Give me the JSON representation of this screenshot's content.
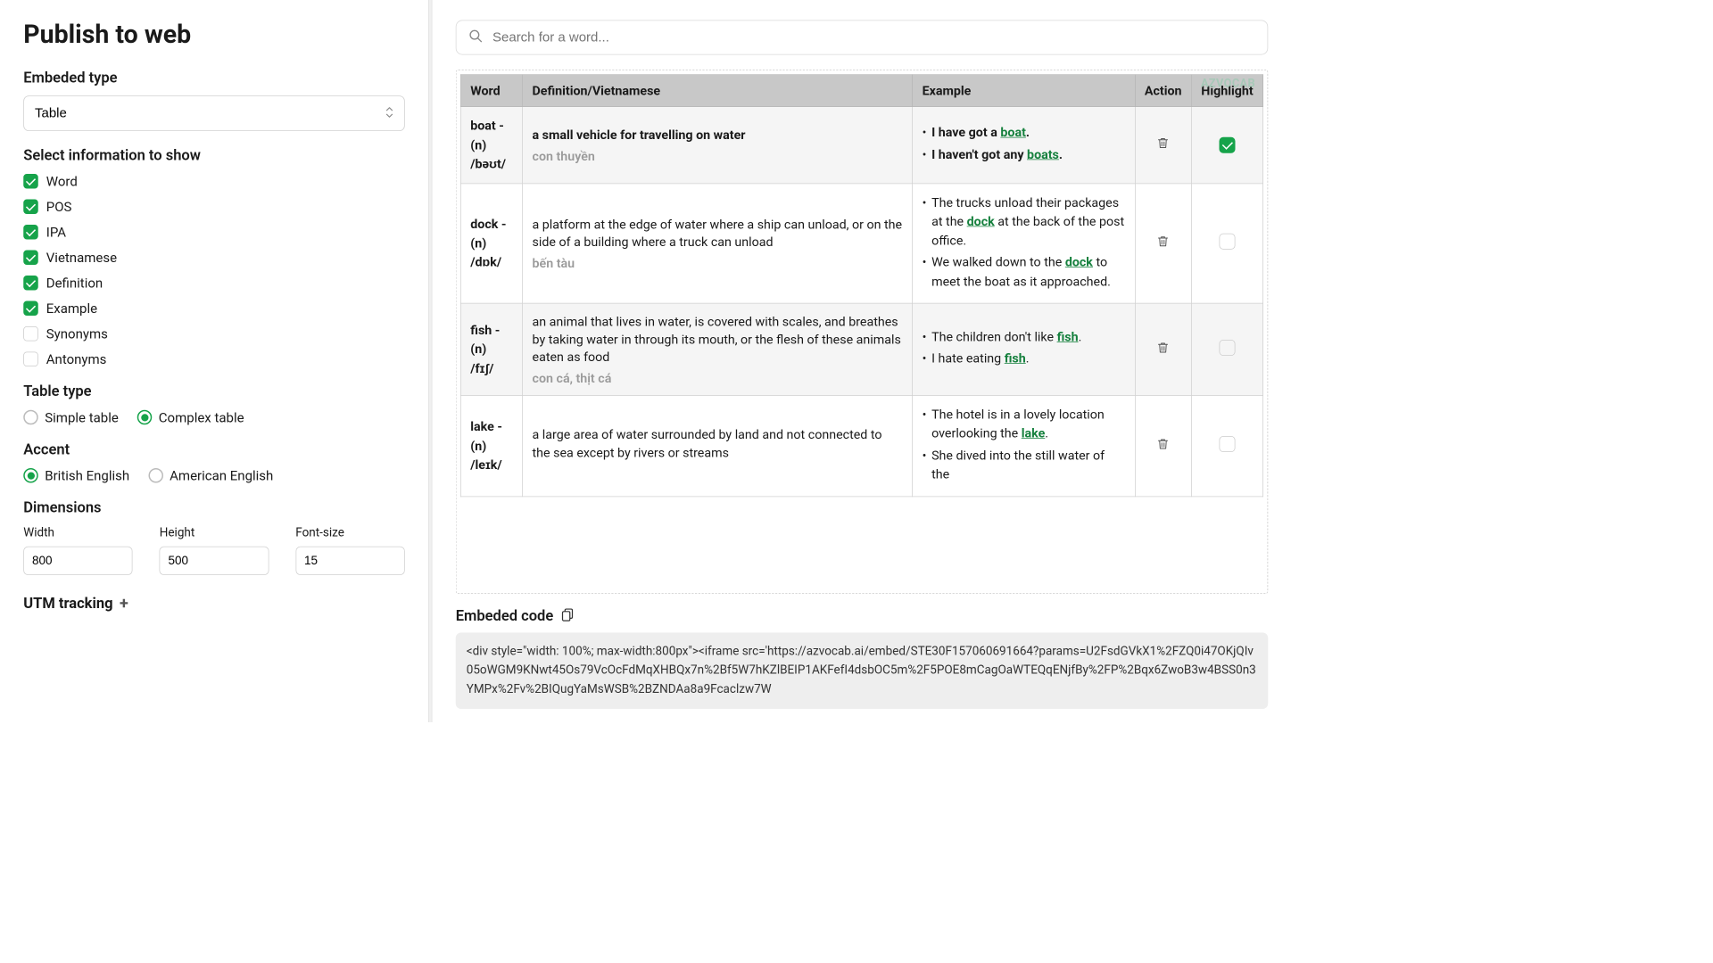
{
  "title": "Publish to web",
  "embed_type": {
    "label": "Embeded type",
    "value": "Table"
  },
  "info": {
    "label": "Select information to show",
    "items": [
      {
        "label": "Word",
        "on": true
      },
      {
        "label": "POS",
        "on": true
      },
      {
        "label": "IPA",
        "on": true
      },
      {
        "label": "Vietnamese",
        "on": true
      },
      {
        "label": "Definition",
        "on": true
      },
      {
        "label": "Example",
        "on": true
      },
      {
        "label": "Synonyms",
        "on": false
      },
      {
        "label": "Antonyms",
        "on": false
      }
    ]
  },
  "table_type": {
    "label": "Table type",
    "options": [
      "Simple table",
      "Complex table"
    ],
    "selected": "Complex table"
  },
  "accent": {
    "label": "Accent",
    "options": [
      "British English",
      "American English"
    ],
    "selected": "British English"
  },
  "dimensions": {
    "label": "Dimensions",
    "width": {
      "label": "Width",
      "value": "800"
    },
    "height": {
      "label": "Height",
      "value": "500"
    },
    "fontsize": {
      "label": "Font-size",
      "value": "15"
    }
  },
  "utm_label": "UTM tracking",
  "search": {
    "placeholder": "Search for a word..."
  },
  "watermark": "AZVOCAB",
  "columns": {
    "word": "Word",
    "def": "Definition/Vietnamese",
    "ex": "Example",
    "act": "Action",
    "hl": "Highlight"
  },
  "rows": [
    {
      "word": "boat - (n)",
      "ipa": "/bəʊt/",
      "def": "a small vehicle for travelling on water",
      "def_bold": true,
      "vn": "con thuyền",
      "ex": [
        {
          "pre": "I have got a ",
          "w": "boat",
          "post": ".",
          "bold": true
        },
        {
          "pre": "I haven't got any ",
          "w": "boats",
          "post": ".",
          "bold": true
        }
      ],
      "hl": true,
      "row_hl": true
    },
    {
      "word": "dock - (n)",
      "ipa": "/dɒk/",
      "def": "a platform at the edge of water where a ship can unload, or on the side of a building where a truck can unload",
      "def_bold": false,
      "vn": "bến tàu",
      "ex": [
        {
          "pre": "The trucks unload their packages at the ",
          "w": "dock",
          "post": " at the back of the post office.",
          "bold": false
        },
        {
          "pre": "We walked down to the ",
          "w": "dock",
          "post": " to meet the boat as it approached.",
          "bold": false
        }
      ],
      "hl": false,
      "row_hl": false
    },
    {
      "word": "fish - (n)",
      "ipa": "/fɪʃ/",
      "def": "an animal that lives in water, is covered with scales, and breathes by taking water in through its mouth, or the flesh of these animals eaten as food",
      "def_bold": false,
      "vn": "con cá, thịt cá",
      "ex": [
        {
          "pre": "The children don't like ",
          "w": "fish",
          "post": ".",
          "bold": false
        },
        {
          "pre": "I hate eating ",
          "w": "fish",
          "post": ".",
          "bold": false
        }
      ],
      "hl": false,
      "row_hl": true
    },
    {
      "word": "lake - (n)",
      "ipa": "/leɪk/",
      "def": "a large area of water surrounded by land and not connected to the sea except by rivers or streams",
      "def_bold": false,
      "vn": "",
      "ex": [
        {
          "pre": "The hotel is in a lovely location overlooking the ",
          "w": "lake",
          "post": ".",
          "bold": false
        },
        {
          "pre": "She dived into the still water of the ",
          "w": "",
          "post": "",
          "bold": false
        }
      ],
      "hl": false,
      "row_hl": false
    }
  ],
  "embed": {
    "label": "Embeded code",
    "code": "<div style=\"width: 100%; max-width:800px\"><iframe src='https://azvocab.ai/embed/STE30F157060691664?params=U2FsdGVkX1%2FZQ0i47OKjQIv05oWGM9KNwt45Os79VcOcFdMqXHBQx7n%2Bf5W7hKZlBEIP1AKFefI4dsbOC5m%2F5POE8mCagOaWTEQqENjfBy%2FP%2Bqx6ZwoB3w4BSS0n3YMPx%2Fv%2BIQugYaMsWSB%2BZNDAa8a9Fcaclzw7W"
  }
}
